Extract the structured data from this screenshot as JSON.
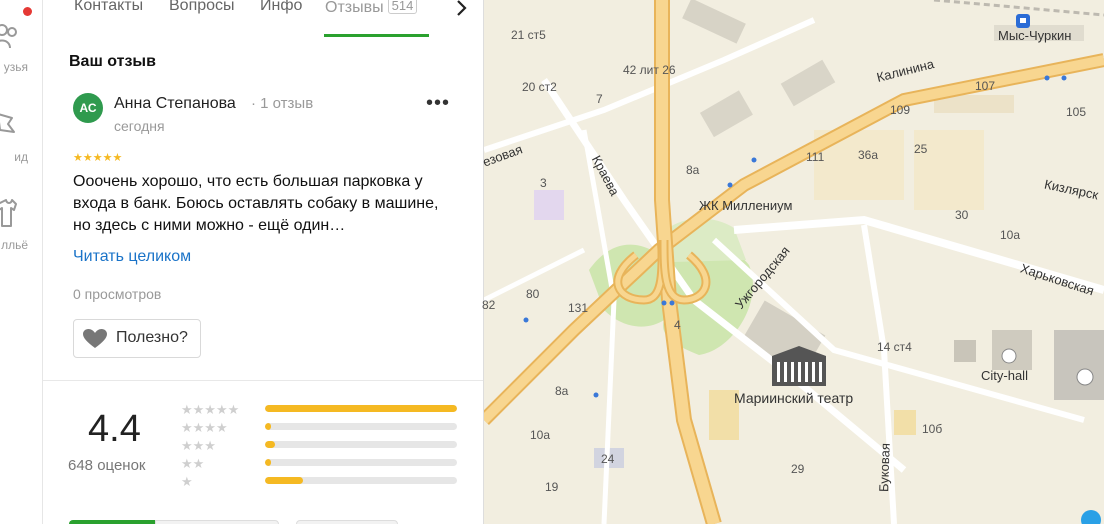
{
  "rail": {
    "items": [
      {
        "label": "узья",
        "icon": "friends-icon"
      },
      {
        "label": "ид",
        "icon": "guide-icon"
      },
      {
        "label": "лльё",
        "icon": "clothes-icon"
      }
    ],
    "notification_color": "#e53935"
  },
  "tabs": [
    {
      "label": "Контакты"
    },
    {
      "label": "Вопросы"
    },
    {
      "label": "Инфо"
    },
    {
      "label": "Отзывы",
      "count": "514",
      "active": true
    }
  ],
  "review": {
    "section_title": "Ваш отзыв",
    "avatar_initials": "АС",
    "author": "Анна Степанова",
    "author_reviews": "· 1 отзыв",
    "date": "сегодня",
    "stars": 5,
    "stars_glyphs": "★★★★★",
    "text": "Ооочень хорошо, что есть большая парковка у входа в банк. Боюсь оставлять собаку в машине, но здесь с ними можно - ещё один…",
    "read_more": "Читать целиком",
    "views": "0 просмотров",
    "useful_label": "Полезно?"
  },
  "rating": {
    "value": "4.4",
    "count_label": "648 оценок",
    "distribution": [
      {
        "stars": "★★★★★",
        "fraction": 1.0
      },
      {
        "stars": "★★★★",
        "fraction": 0.03
      },
      {
        "stars": "★★★",
        "fraction": 0.05
      },
      {
        "stars": "★★",
        "fraction": 0.03
      },
      {
        "stars": "★",
        "fraction": 0.2
      }
    ],
    "accent": "#f5b922"
  },
  "map": {
    "metro_station": "Мыс-Чуркин",
    "streets": {
      "kalinina": "Калинина",
      "kraeva": "Краева",
      "uzhgorodskaya": "Ужгородская",
      "kharkovskaya": "Харьковская",
      "kizlyarskaya": "Кизлярск",
      "bukovaya": "Буковая",
      "bereznaya": "езовая"
    },
    "pois": {
      "millennium": "ЖК Миллениум",
      "mariinsky": "Мариинский театр",
      "cityhall": "City-hall"
    },
    "house_numbers": [
      "21 ст5",
      "20 ст2",
      "42 лит 26",
      "7",
      "3",
      "8а",
      "111",
      "36а",
      "25",
      "30",
      "10а",
      "107",
      "109",
      "105",
      "80",
      "131",
      "8а",
      "10а",
      "24",
      "19",
      "14 ст4",
      "10б",
      "29",
      "82",
      "4"
    ]
  },
  "colors": {
    "brand_green": "#2aa12e",
    "link": "#1a73c8",
    "road_major": "#f6c36b"
  }
}
